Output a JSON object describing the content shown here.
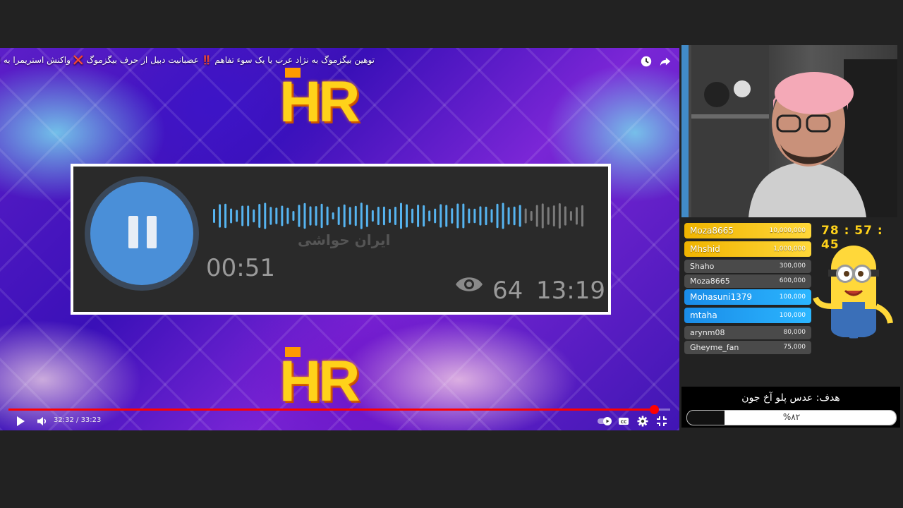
{
  "video": {
    "title": "توهین بیگزموگ به نژاد عرب یا یک سوء تفاهم ‼️ عصبانیت دبیل از حرف بیگزموگ ❌ واکنش استریمرا به این دراما",
    "logo_text": "HR",
    "voice_card": {
      "channel_name": "ایران حواشی",
      "duration": "00:51",
      "views": "64",
      "time": "13:19",
      "progress": 0.82
    },
    "player": {
      "current_time": "32:32",
      "total_time": "33:23",
      "progress": 0.975,
      "accent": "#ff0000"
    }
  },
  "stream": {
    "timer": "78 : 57 : 45",
    "leaderboard": [
      {
        "name": "Moza8665",
        "amount": "10,000,000",
        "style": "gold"
      },
      {
        "name": "Mhshid",
        "amount": "1,000,000",
        "style": "gold"
      },
      {
        "name": "Shaho",
        "amount": "300,000",
        "style": "grey"
      },
      {
        "name": "Moza8665",
        "amount": "600,000",
        "style": "grey"
      },
      {
        "name": "Mohasuni1379",
        "amount": "100,000",
        "style": "blue"
      },
      {
        "name": "mtaha",
        "amount": "100,000",
        "style": "blue"
      },
      {
        "name": "arynm08",
        "amount": "80,000",
        "style": "grey"
      },
      {
        "name": "Gheyme_fan",
        "amount": "75,000",
        "style": "grey"
      }
    ],
    "goal": {
      "title": "هدف: عدس پلو آخ جون",
      "percent_label": "%۸۲",
      "progress": 0.82
    }
  },
  "icons": {
    "watch_later": "clock-icon",
    "share": "share-icon",
    "play": "play-icon",
    "volume": "volume-icon",
    "autoplay": "autoplay-toggle",
    "captions": "captions-icon",
    "settings": "gear-icon",
    "fullscreen": "exit-fullscreen-icon"
  }
}
